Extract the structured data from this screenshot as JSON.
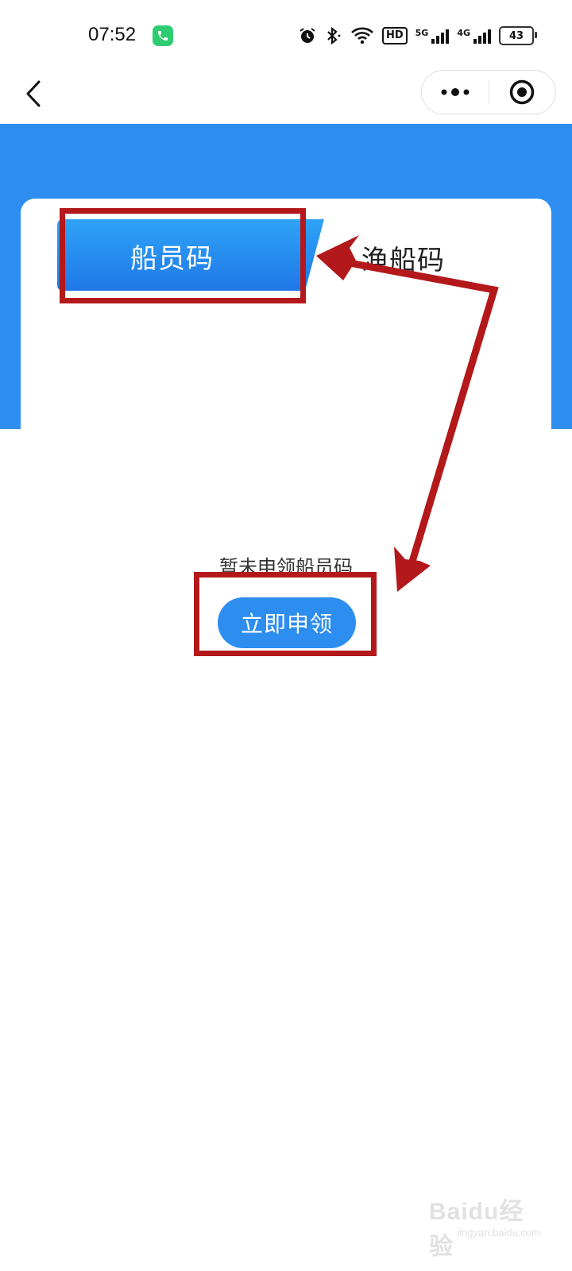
{
  "status_bar": {
    "time": "07:52",
    "hd_label": "HD",
    "net1_label": "5G",
    "net2_label": "4G",
    "battery_level": "43"
  },
  "nav": {
    "back_icon": "chevron-left-icon",
    "more_icon": "more-dots-icon",
    "target_icon": "target-icon"
  },
  "tabs": [
    {
      "label": "船员码",
      "active": true
    },
    {
      "label": "渔船码",
      "active": false
    }
  ],
  "empty_state": {
    "message": "暂未申领船员码",
    "button_label": "立即申领"
  },
  "colors": {
    "primary_blue": "#2d8ef0",
    "annotation_red": "#b3181b"
  },
  "watermark": {
    "logo": "Baidu经验",
    "url": "jingyan.baidu.com"
  }
}
